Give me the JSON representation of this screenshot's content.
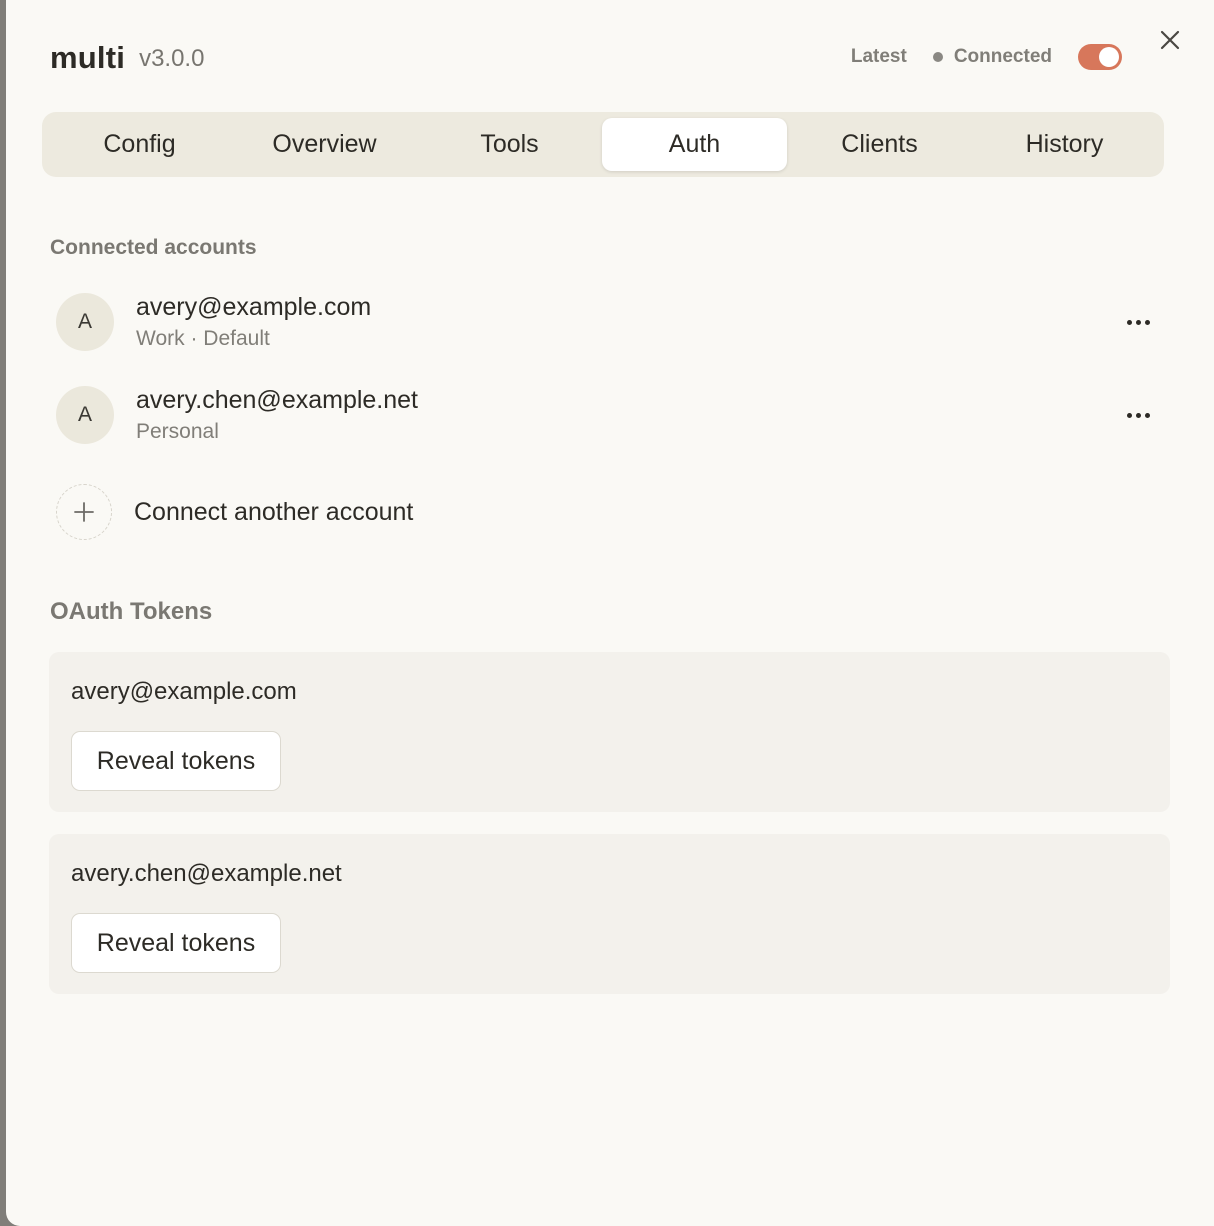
{
  "header": {
    "title": "multi",
    "version": "v3.0.0",
    "latest_label": "Latest",
    "status_label": "Connected",
    "toggle_on": true,
    "accent_color": "#d7775b"
  },
  "tabs": [
    {
      "label": "Config",
      "active": false
    },
    {
      "label": "Overview",
      "active": false
    },
    {
      "label": "Tools",
      "active": false
    },
    {
      "label": "Auth",
      "active": true
    },
    {
      "label": "Clients",
      "active": false
    },
    {
      "label": "History",
      "active": false
    }
  ],
  "connected_accounts": {
    "heading": "Connected accounts",
    "accounts": [
      {
        "initial": "A",
        "email": "avery@example.com",
        "sub": "Work · Default"
      },
      {
        "initial": "A",
        "email": "avery.chen@example.net",
        "sub": "Personal"
      }
    ],
    "add_label": "Connect another account"
  },
  "oauth_tokens": {
    "heading": "OAuth Tokens",
    "cards": [
      {
        "email": "avery@example.com",
        "button_label": "Reveal tokens"
      },
      {
        "email": "avery.chen@example.net",
        "button_label": "Reveal tokens"
      }
    ]
  },
  "icons": {
    "close": "close-icon",
    "more": "more-horizontal-icon",
    "add": "plus-icon"
  }
}
